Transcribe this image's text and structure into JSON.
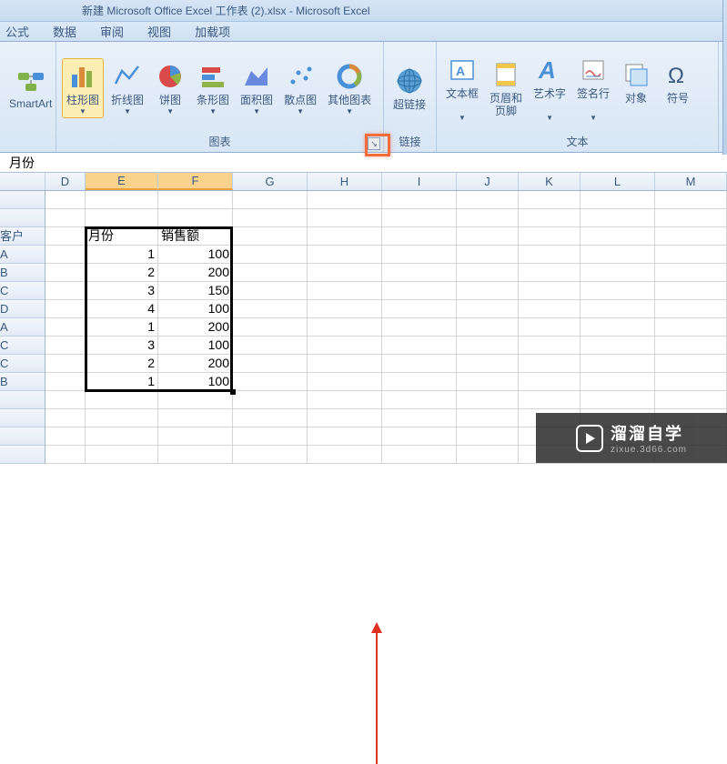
{
  "title": "新建 Microsoft Office Excel 工作表 (2).xlsx - Microsoft Excel",
  "menu": {
    "m1": "公式",
    "m2": "数据",
    "m3": "审阅",
    "m4": "视图",
    "m5": "加载项"
  },
  "ribbon": {
    "smartart": "SmartArt",
    "charts": {
      "column": "柱形图",
      "line": "折线图",
      "pie": "饼图",
      "bar": "条形图",
      "area": "面积图",
      "scatter": "散点图",
      "other": "其他图表",
      "group": "图表"
    },
    "links": {
      "hyperlink": "超链接",
      "group": "链接"
    },
    "text": {
      "textbox": "文本框",
      "headerfooter": "页眉和\n页脚",
      "wordart": "艺术字",
      "sigline": "签名行",
      "object": "对象",
      "symbol": "符号",
      "group": "文本"
    }
  },
  "formula_bar": "月份",
  "columns": [
    "D",
    "E",
    "F",
    "G",
    "H",
    "I",
    "J",
    "K",
    "L",
    "M"
  ],
  "rowhead": [
    "",
    "",
    "客户",
    "A",
    "B",
    "C",
    "D",
    "A",
    "C",
    "C",
    "B",
    "",
    "",
    ""
  ],
  "tableE": [
    "",
    "",
    "月份",
    "1",
    "2",
    "3",
    "4",
    "1",
    "3",
    "2",
    "1",
    "",
    "",
    ""
  ],
  "tableF": [
    "",
    "",
    "销售额",
    "100",
    "200",
    "150",
    "100",
    "200",
    "100",
    "200",
    "100",
    "",
    "",
    ""
  ],
  "watermark": {
    "brand": "溜溜自学",
    "url": "zixue.3d66.com"
  }
}
